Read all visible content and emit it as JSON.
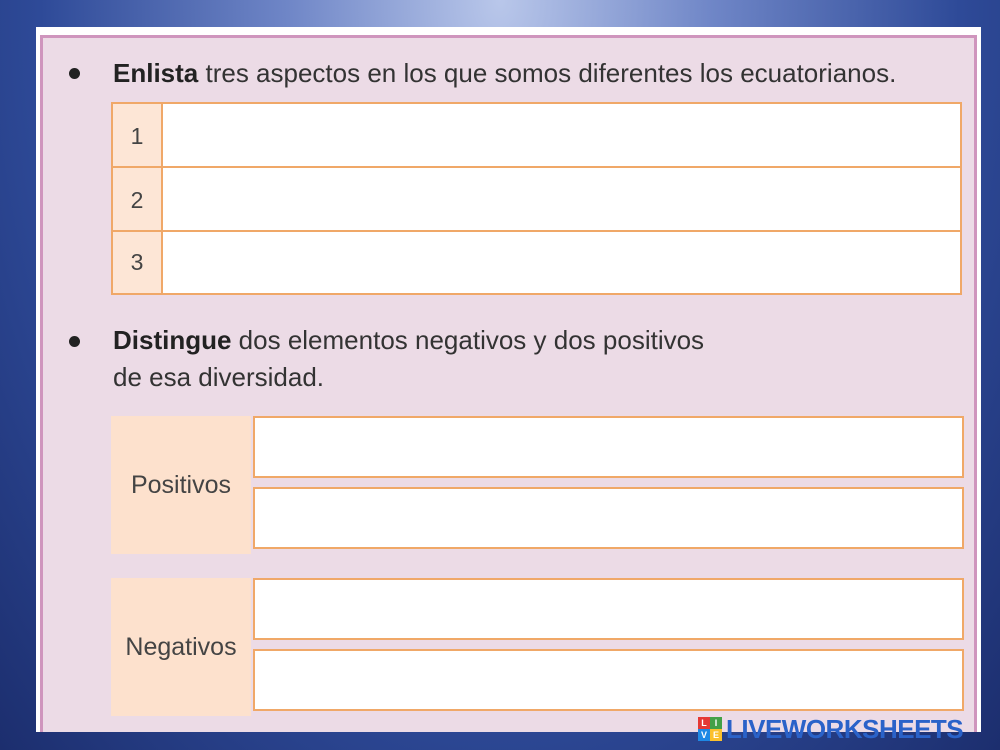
{
  "section1": {
    "bold": "Enlista",
    "text": " tres aspectos en los que somos diferentes los ecuatorianos.",
    "rows": [
      "1",
      "2",
      "3"
    ]
  },
  "section2": {
    "bold": "Distingue",
    "text_line1": " dos elementos negativos y dos positivos",
    "text_line2": "de esa diversidad."
  },
  "groups": {
    "positive_label": "Positivos",
    "negative_label": "Negativos"
  },
  "brand": {
    "logo_letters": [
      "L",
      "I",
      "V",
      "E"
    ],
    "logo_colors": [
      "#e53935",
      "#43a047",
      "#1e88e5",
      "#fbc02d"
    ],
    "name": "LIVEWORKSHEETS"
  }
}
